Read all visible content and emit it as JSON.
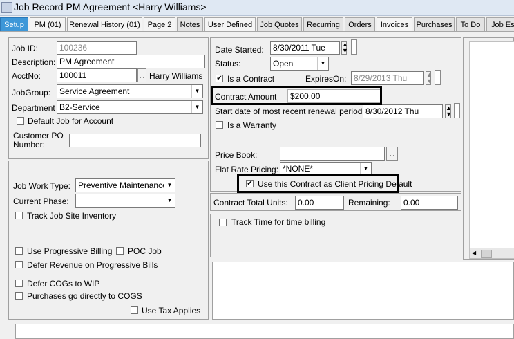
{
  "window": {
    "title": "Job Record PM Agreement <Harry Williams>"
  },
  "tabs": [
    {
      "label": "Setup"
    },
    {
      "label": "PM (01)"
    },
    {
      "label": "Renewal History (01)"
    },
    {
      "label": "Page 2"
    },
    {
      "label": "Notes"
    },
    {
      "label": "User Defined"
    },
    {
      "label": "Job Quotes"
    },
    {
      "label": "Recurring"
    },
    {
      "label": "Orders"
    },
    {
      "label": "Invoices"
    },
    {
      "label": "Purchases"
    },
    {
      "label": "To Do"
    },
    {
      "label": "Job Estimates"
    }
  ],
  "job": {
    "job_id_label": "Job ID:",
    "job_id": "100236",
    "description_label": "Description:",
    "description": "PM Agreement",
    "acctno_label": "AcctNo:",
    "acctno": "100011",
    "acct_name": "Harry Williams",
    "acct_lookup": "...",
    "jobgroup_label": "JobGroup:",
    "jobgroup": "Service Agreement",
    "department_label": "Department",
    "department": "B2-Service",
    "default_job_label": "Default Job for Account",
    "customer_po_label_1": "Customer PO",
    "customer_po_label_2": "Number:",
    "customer_po": ""
  },
  "dates": {
    "date_started_label": "Date Started:",
    "date_started": "8/30/2011 Tue",
    "status_label": "Status:",
    "status": "Open",
    "is_contract_label": "Is a Contract",
    "is_contract_checked": "✔",
    "expires_label": "ExpiresOn:",
    "expires": "8/29/2013 Thu",
    "contract_amount_label": "Contract Amount",
    "contract_amount": "$200.00",
    "renewal_label": "Start date of most recent renewal period:",
    "renewal": "8/30/2012 Thu",
    "is_warranty_label": "Is a Warranty",
    "price_book_label": "Price Book:",
    "price_book": "",
    "price_book_lookup": "...",
    "flat_rate_label": "Flat Rate Pricing:",
    "flat_rate": "*NONE*",
    "client_pricing_label": "Use this Contract as Client Pricing Default",
    "client_pricing_checked": "✔"
  },
  "work": {
    "work_type_label": "Job Work Type:",
    "work_type": "Preventive Maintenance",
    "phase_label": "Current Phase:",
    "phase": "",
    "track_inventory_label": "Track Job Site Inventory",
    "progressive_billing_label": "Use Progressive Billing",
    "poc_job_label": "POC Job",
    "defer_revenue_label": "Defer Revenue on Progressive Bills",
    "defer_cogs_label": "Defer COGs to WIP",
    "purchases_cogs_label": "Purchases go directly to COGS",
    "use_tax_label": "Use Tax Applies"
  },
  "units": {
    "total_label": "Contract Total Units:",
    "total": "0.00",
    "remaining_label": "Remaining:",
    "remaining": "0.00",
    "track_time_label": "Track Time for time billing"
  }
}
